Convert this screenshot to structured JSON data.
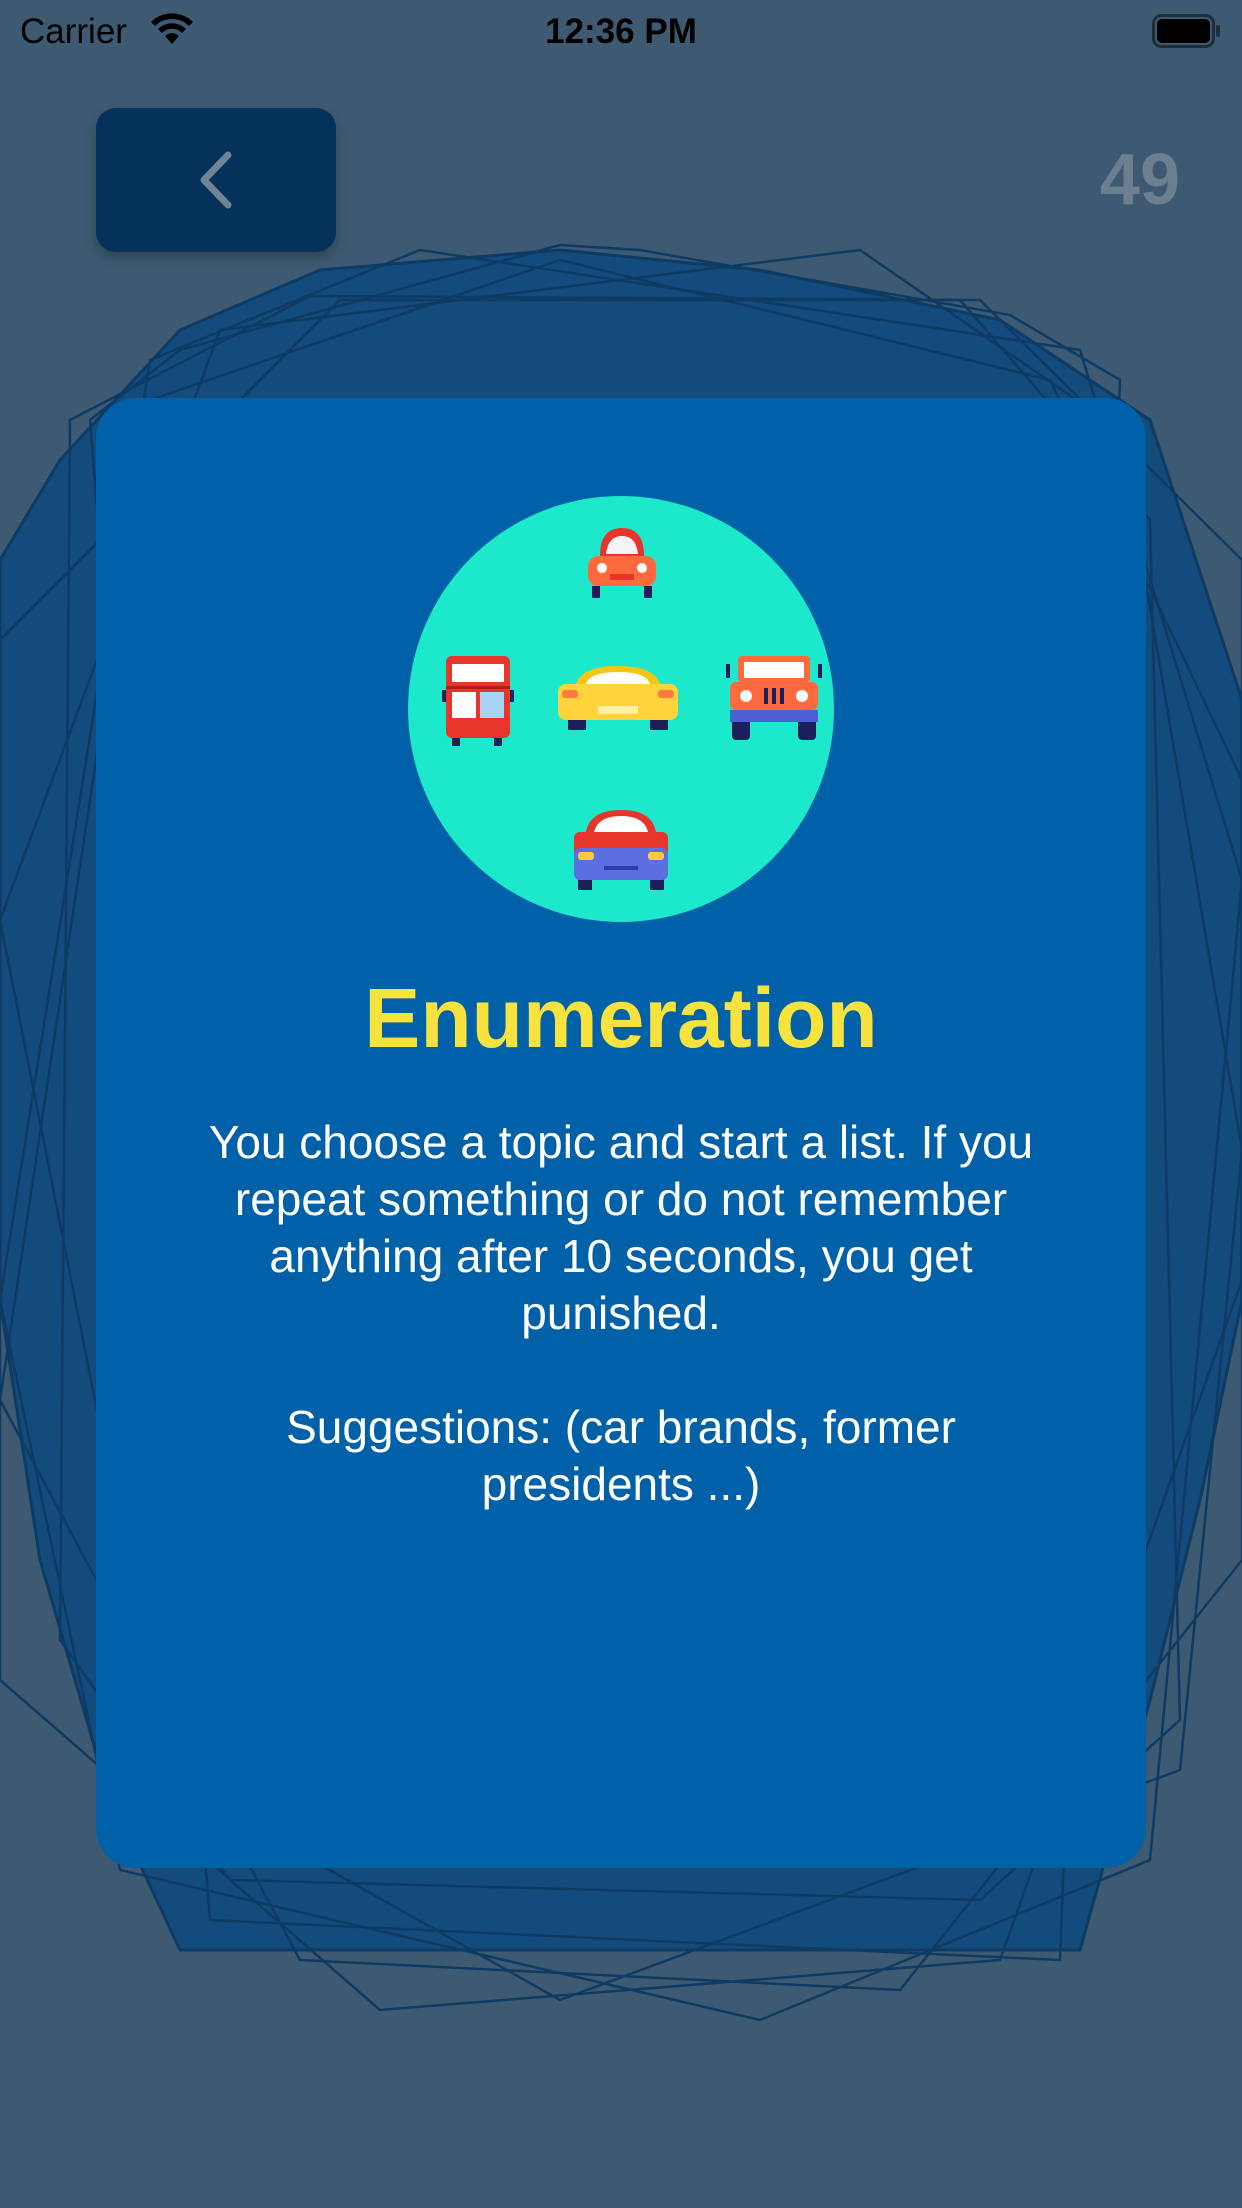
{
  "status_bar": {
    "carrier": "Carrier",
    "time": "12:36 PM"
  },
  "header": {
    "back_icon": "chevron-left-icon",
    "counter": "49"
  },
  "card": {
    "illustration": "vehicles-icon",
    "title": "Enumeration",
    "description": "You choose a topic and start a list. If you repeat something or do not remember anything after 10 seconds, you get punished.\n\nSuggestions: (car brands, former presidents ...)"
  },
  "colors": {
    "background": "#3e5a72",
    "card": "#0060a8",
    "title": "#f7e23e",
    "illustration_circle": "#1ce8cc",
    "back_button": "#05325a"
  }
}
